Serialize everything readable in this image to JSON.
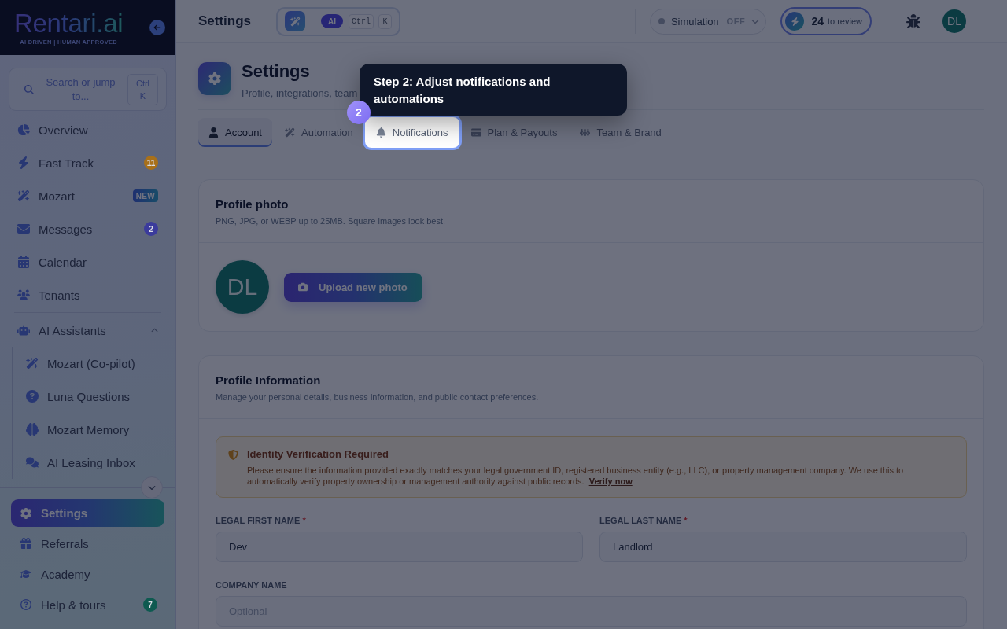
{
  "sidebar": {
    "logo": {
      "name": "Rentari.ai",
      "tagline": "AI DRIVEN | HUMAN APPROVED"
    },
    "search": {
      "placeholder": "Search or jump to...",
      "shortcut": [
        "Ctrl",
        "K"
      ]
    },
    "nav_items": [
      {
        "label": "Overview",
        "selected": false
      },
      {
        "label": "Fast Track",
        "selected": false,
        "badge": {
          "kind": "count",
          "text": "11",
          "color": "#a8701a"
        }
      },
      {
        "label": "Mozart",
        "selected": false,
        "badge": {
          "kind": "tag",
          "text": "NEW"
        }
      },
      {
        "label": "Messages",
        "selected": false,
        "badge": {
          "kind": "count",
          "text": "2",
          "color": "#3b3b9c"
        }
      },
      {
        "label": "Calendar",
        "selected": false
      },
      {
        "label": "Tenants",
        "selected": false
      },
      {
        "label": "AI Assistants",
        "selected": false,
        "expanded": true,
        "children": [
          {
            "label": "Mozart (Co-pilot)",
            "selected": false
          },
          {
            "label": "Luna Questions",
            "selected": false
          },
          {
            "label": "Mozart Memory",
            "selected": false
          },
          {
            "label": "AI Leasing Inbox",
            "selected": false
          }
        ]
      }
    ],
    "bottom_items": [
      {
        "label": "Settings",
        "selected": true
      },
      {
        "label": "Referrals",
        "selected": false
      },
      {
        "label": "Academy",
        "selected": false
      },
      {
        "label": "Help & tours",
        "selected": false,
        "badge": {
          "kind": "count",
          "text": "7",
          "color": "#0e5a50"
        }
      }
    ]
  },
  "top_bar": {
    "title": "Settings",
    "command_bar": {
      "ai_label": "AI",
      "keys": [
        "Ctrl",
        "K"
      ]
    },
    "simulation": {
      "label": "Simulation",
      "state": "OFF",
      "on": false
    },
    "review": {
      "count": "24",
      "label": "to review"
    },
    "avatar_initials": "DL"
  },
  "page_header": {
    "title": "Settings",
    "subtitle": "Profile, integrations, team"
  },
  "tabs": [
    {
      "label": "Account",
      "selected": true,
      "highlighted": false
    },
    {
      "label": "Automation",
      "selected": false,
      "highlighted": false
    },
    {
      "label": "Notifications",
      "selected": false,
      "highlighted": true
    },
    {
      "label": "Plan & Payouts",
      "selected": false,
      "highlighted": false
    },
    {
      "label": "Team & Brand",
      "selected": false,
      "highlighted": false
    }
  ],
  "profile_photo": {
    "title": "Profile photo",
    "subtitle": "PNG, JPG, or WEBP up to 25MB. Square images look best.",
    "avatar_initials": "DL",
    "upload_button": "Upload new photo"
  },
  "profile_information": {
    "title": "Profile Information",
    "subtitle": "Manage your personal details, business information, and public contact preferences.",
    "alert": {
      "title": "Identity Verification Required",
      "text": "Please ensure the information provided exactly matches your legal government ID, registered business entity (e.g., LLC), or property management company. We use this to automatically verify property ownership or management authority against public records.",
      "link": "Verify now"
    },
    "field_rows": [
      [
        {
          "label": "LEGAL FIRST NAME",
          "required_mark": "*",
          "value": "Dev"
        },
        {
          "label": "LEGAL LAST NAME",
          "required_mark": "*",
          "value": "Landlord"
        }
      ],
      [
        {
          "label": "COMPANY NAME",
          "placeholder": "Optional"
        }
      ]
    ]
  },
  "tour": {
    "step": "2",
    "text": "Step 2: Adjust notifications and automations"
  }
}
